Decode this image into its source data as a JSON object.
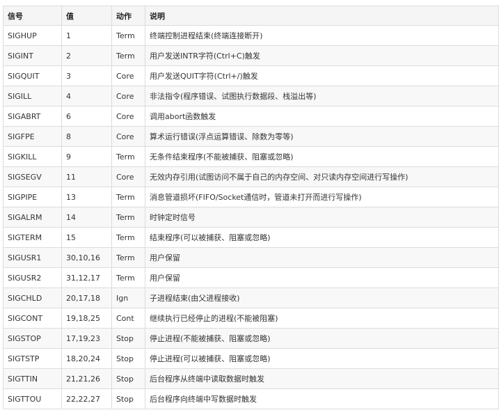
{
  "table": {
    "headers": [
      "信号",
      "值",
      "动作",
      "说明"
    ],
    "rows": [
      [
        "SIGHUP",
        "1",
        "Term",
        "终端控制进程结束(终端连接断开)"
      ],
      [
        "SIGINT",
        "2",
        "Term",
        "用户发送INTR字符(Ctrl+C)触发"
      ],
      [
        "SIGQUIT",
        "3",
        "Core",
        "用户发送QUIT字符(Ctrl+/)触发"
      ],
      [
        "SIGILL",
        "4",
        "Core",
        "非法指令(程序错误、试图执行数据段、栈溢出等)"
      ],
      [
        "SIGABRT",
        "6",
        "Core",
        "调用abort函数触发"
      ],
      [
        "SIGFPE",
        "8",
        "Core",
        "算术运行错误(浮点运算错误、除数为零等)"
      ],
      [
        "SIGKILL",
        "9",
        "Term",
        "无条件结束程序(不能被捕获、阻塞或忽略)"
      ],
      [
        "SIGSEGV",
        "11",
        "Core",
        "无效内存引用(试图访问不属于自己的内存空间、对只读内存空间进行写操作)"
      ],
      [
        "SIGPIPE",
        "13",
        "Term",
        "消息管道损坏(FIFO/Socket通信时，管道未打开而进行写操作)"
      ],
      [
        "SIGALRM",
        "14",
        "Term",
        "时钟定时信号"
      ],
      [
        "SIGTERM",
        "15",
        "Term",
        "结束程序(可以被捕获、阻塞或忽略)"
      ],
      [
        "SIGUSR1",
        "30,10,16",
        "Term",
        "用户保留"
      ],
      [
        "SIGUSR2",
        "31,12,17",
        "Term",
        "用户保留"
      ],
      [
        "SIGCHLD",
        "20,17,18",
        "Ign",
        "子进程结束(由父进程接收)"
      ],
      [
        "SIGCONT",
        "19,18,25",
        "Cont",
        "继续执行已经停止的进程(不能被阻塞)"
      ],
      [
        "SIGSTOP",
        "17,19,23",
        "Stop",
        "停止进程(不能被捕获、阻塞或忽略)"
      ],
      [
        "SIGTSTP",
        "18,20,24",
        "Stop",
        "停止进程(可以被捕获、阻塞或忽略)"
      ],
      [
        "SIGTTIN",
        "21,21,26",
        "Stop",
        "后台程序从终端中读取数据时触发"
      ],
      [
        "SIGTTOU",
        "22,22,27",
        "Stop",
        "后台程序向终端中写数据时触发"
      ]
    ]
  }
}
